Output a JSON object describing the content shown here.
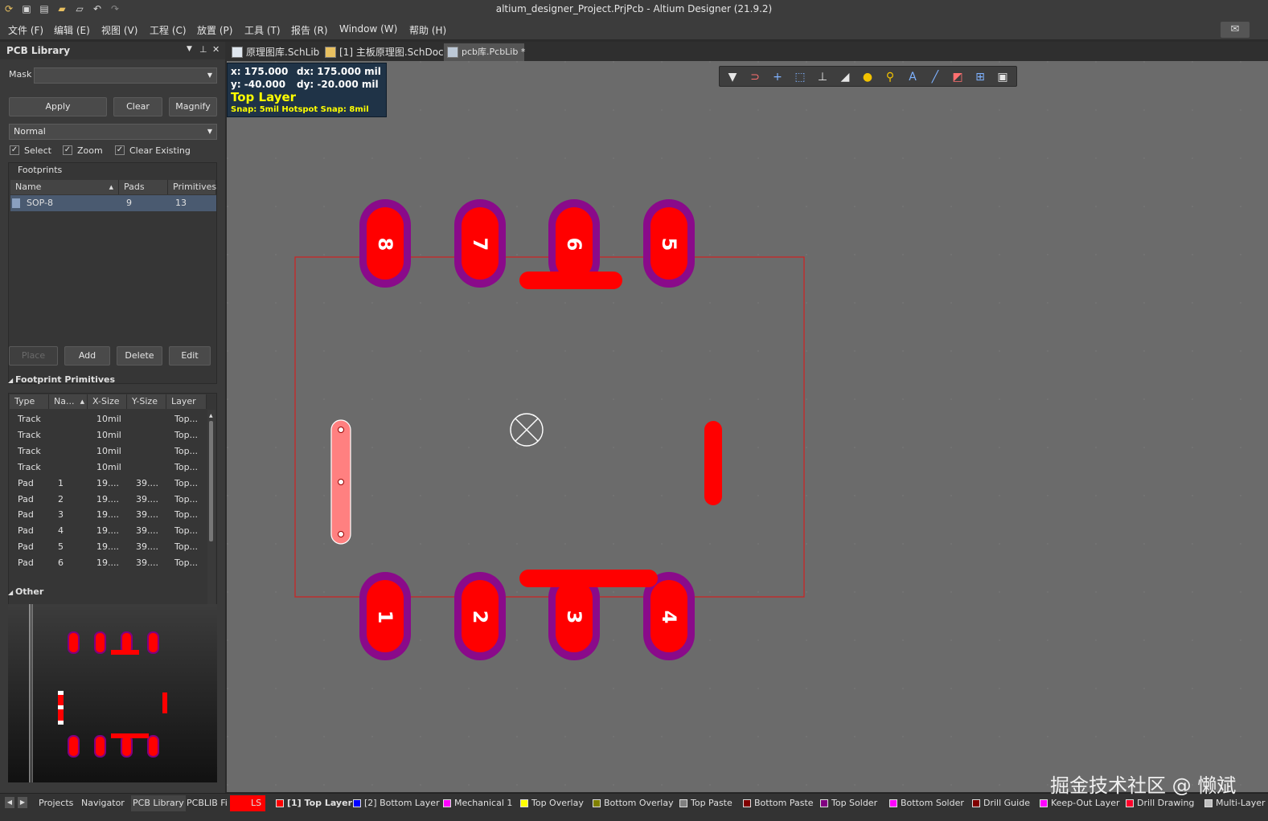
{
  "window": {
    "title": "altium_designer_Project.PrjPcb - Altium Designer (21.9.2)"
  },
  "menu": [
    "文件 (F)",
    "编辑 (E)",
    "视图 (V)",
    "工程 (C)",
    "放置 (P)",
    "工具 (T)",
    "报告 (R)",
    "Window (W)",
    "帮助 (H)"
  ],
  "panel": {
    "title": "PCB Library",
    "mask_label": "Mask",
    "mask_value": "",
    "apply": "Apply",
    "clear": "Clear",
    "magnify": "Magnify",
    "mode": "Normal",
    "check_select": "Select",
    "check_zoom": "Zoom",
    "check_clear_existing": "Clear Existing",
    "footprints_title": "Footprints",
    "fp_columns": [
      "Name",
      "Pads",
      "Primitives"
    ],
    "fp_rows": [
      {
        "name": "SOP-8",
        "pads": "9",
        "primitives": "13"
      }
    ],
    "place": "Place",
    "add": "Add",
    "delete": "Delete",
    "edit": "Edit",
    "primitives_title": "Footprint Primitives",
    "prim_columns": [
      "Type",
      "Na...",
      "X-Size",
      "Y-Size",
      "Layer"
    ],
    "prim_rows": [
      {
        "type": "Track",
        "name": "",
        "xsize": "10mil",
        "ysize": "",
        "layer": "Top..."
      },
      {
        "type": "Track",
        "name": "",
        "xsize": "10mil",
        "ysize": "",
        "layer": "Top..."
      },
      {
        "type": "Track",
        "name": "",
        "xsize": "10mil",
        "ysize": "",
        "layer": "Top..."
      },
      {
        "type": "Track",
        "name": "",
        "xsize": "10mil",
        "ysize": "",
        "layer": "Top..."
      },
      {
        "type": "Pad",
        "name": "1",
        "xsize": "19....",
        "ysize": "39....",
        "layer": "Top..."
      },
      {
        "type": "Pad",
        "name": "2",
        "xsize": "19....",
        "ysize": "39....",
        "layer": "Top..."
      },
      {
        "type": "Pad",
        "name": "3",
        "xsize": "19....",
        "ysize": "39....",
        "layer": "Top..."
      },
      {
        "type": "Pad",
        "name": "4",
        "xsize": "19....",
        "ysize": "39....",
        "layer": "Top..."
      },
      {
        "type": "Pad",
        "name": "5",
        "xsize": "19....",
        "ysize": "39....",
        "layer": "Top..."
      },
      {
        "type": "Pad",
        "name": "6",
        "xsize": "19....",
        "ysize": "39....",
        "layer": "Top..."
      }
    ],
    "other_title": "Other"
  },
  "tabs": [
    {
      "label": "原理图库.SchLib",
      "active": false
    },
    {
      "label": "[1] 主板原理图.SchDoc",
      "active": false
    },
    {
      "label": "pcb库.PcbLib *",
      "active": true
    }
  ],
  "hud": {
    "x": "x:  175.000",
    "dx": "dx:  175.000 mil",
    "y": "y:  -40.000",
    "dy": "dy:  -20.000  mil",
    "layer": "Top Layer",
    "snap": "Snap: 5mil Hotspot Snap: 8mil"
  },
  "pads": {
    "top": [
      "8",
      "7",
      "6",
      "5"
    ],
    "bottom": [
      "1",
      "2",
      "3",
      "4"
    ]
  },
  "bottom_tabs": [
    "Projects",
    "Navigator",
    "PCB Library",
    "PCBLIB Fi"
  ],
  "layers": [
    {
      "label": "LS",
      "color": "#ff0000"
    },
    {
      "label": "[1] Top Layer",
      "color": "#ff0000",
      "active": true
    },
    {
      "label": "[2] Bottom Layer",
      "color": "#0000ff"
    },
    {
      "label": "Mechanical 1",
      "color": "#ff00ff"
    },
    {
      "label": "Top Overlay",
      "color": "#ffff00"
    },
    {
      "label": "Bottom Overlay",
      "color": "#808000"
    },
    {
      "label": "Top Paste",
      "color": "#808080"
    },
    {
      "label": "Bottom Paste",
      "color": "#800000"
    },
    {
      "label": "Top Solder",
      "color": "#800080"
    },
    {
      "label": "Bottom Solder",
      "color": "#ff00ff"
    },
    {
      "label": "Drill Guide",
      "color": "#800000"
    },
    {
      "label": "Keep-Out Layer",
      "color": "#ff00ff"
    },
    {
      "label": "Drill Drawing",
      "color": "#ff002a"
    },
    {
      "label": "Multi-Layer",
      "color": "#c0c0c0"
    }
  ],
  "watermark": "掘金技术社区 @ 懒斌"
}
